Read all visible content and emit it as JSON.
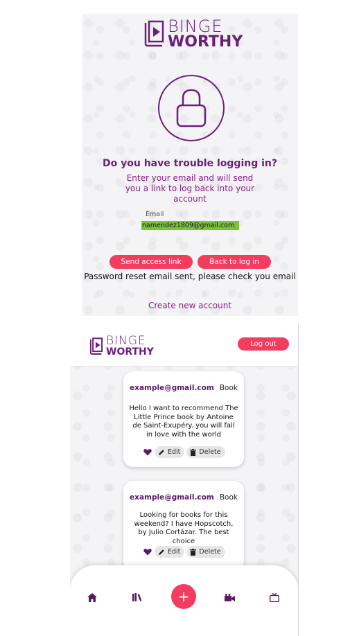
{
  "reset_screen": {
    "logo": {
      "line1": "BINGE",
      "line2": "WORTHY"
    },
    "heading": "Do you have trouble logging in?",
    "subtext": "Enter your email and will send you a link to log back into your account",
    "email": {
      "label": "Email",
      "value": "namendez1809@gmail.com"
    },
    "buttons": {
      "send": "Send access link",
      "back": "Back to log in"
    },
    "status": "Password reset email sent, please check you email",
    "create_account": "Create new account",
    "colors": {
      "primary": "#6b1f7a",
      "accent": "#f23d5f",
      "autofill": "#79c23a"
    }
  },
  "feed_screen": {
    "logo": {
      "line1": "BINGE",
      "line2": "WORTHY"
    },
    "logout": "Log out",
    "posts": [
      {
        "email": "example@gmail.com",
        "type": "Book",
        "text": "Hello I want to recommend The Little Prince book by Antoine de Saint-Exupéry. you will fall in love with the world",
        "edit": "Edit",
        "delete": "Delete"
      },
      {
        "email": "example@gmail.com",
        "type": "Book",
        "text": "Looking for books for this weekend? I have Hopscotch, by Julio Cortázar. The best choice",
        "edit": "Edit",
        "delete": "Delete"
      }
    ],
    "nav": {
      "items": [
        "home-icon",
        "books-icon",
        "add-icon",
        "movies-icon",
        "tv-icon"
      ],
      "add_label": "+"
    }
  }
}
